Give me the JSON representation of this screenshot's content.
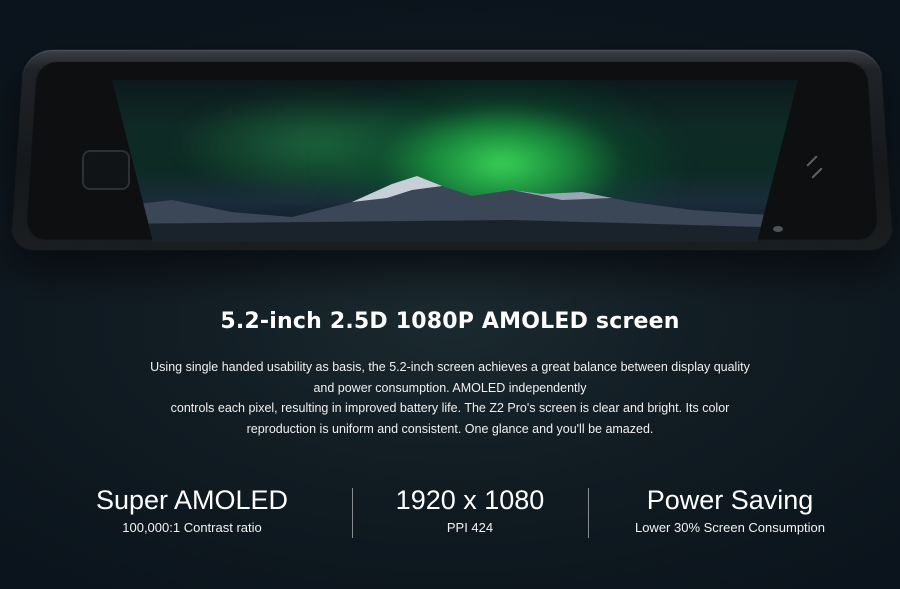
{
  "headline": "5.2-inch 2.5D 1080P AMOLED screen",
  "description": {
    "lines": [
      "Using single handed usability as basis, the 5.2-inch screen achieves a great balance between display quality",
      "and power consumption. AMOLED independently",
      "controls each pixel, resulting in improved battery life. The Z2 Pro's screen is clear and bright. Its color",
      "reproduction is uniform and consistent. One glance and you'll be amazed."
    ]
  },
  "stats": [
    {
      "title": "Super AMOLED",
      "subtitle": "100,000:1 Contrast ratio"
    },
    {
      "title": "1920 x 1080",
      "subtitle": "PPI 424"
    },
    {
      "title": "Power Saving",
      "subtitle": "Lower 30% Screen Consumption"
    }
  ],
  "colors": {
    "background": "#111c23",
    "aurora": "#3cdc5a",
    "text": "#ffffff"
  }
}
